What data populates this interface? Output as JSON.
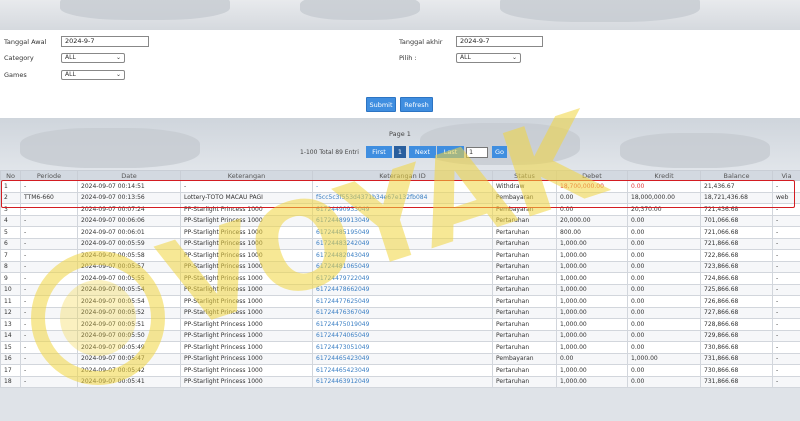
{
  "filters": {
    "tanggal_awal_label": "Tanggal Awal",
    "tanggal_awal_value": "2024-9-7",
    "category_label": "Category",
    "category_value": "ALL",
    "games_label": "Games",
    "games_value": "ALL",
    "tanggal_akhir_label": "Tanggal akhir",
    "tanggal_akhir_value": "2024-9-7",
    "pilih_label": "Pilih :",
    "pilih_value": "ALL",
    "submit_label": "Submit",
    "refresh_label": "Refresh"
  },
  "pager": {
    "page_title": "Page 1",
    "summary": "1-100 Total 89 Entri",
    "first": "First",
    "current": "1",
    "next": "Next",
    "last": "Last",
    "page_input": "1",
    "go": "Go"
  },
  "table": {
    "headers": [
      "No",
      "Periode",
      "Date",
      "Keterangan",
      "Keterangan ID",
      "Status",
      "Debet",
      "Kredit",
      "Balance",
      "Via"
    ],
    "rows": [
      [
        "1",
        "-",
        "2024-09-07 00:14:51",
        "-",
        "-",
        "Withdraw",
        "18,700,000.00",
        "0.00",
        "21,436.67",
        "-"
      ],
      [
        "2",
        "TTM6-660",
        "2024-09-07 00:13:56",
        "Lottery-TOTO MACAU PAGI",
        "f5cc5c3f553d4371b34e67e132fb084",
        "Pembayaran",
        "0.00",
        "18,000,000.00",
        "18,721,436.68",
        "web"
      ],
      [
        "3",
        "-",
        "2024-09-07 00:07:24",
        "PP-Starlight Princess 1000",
        "61724490933049",
        "Pembayaran",
        "0.00",
        "20,370.00",
        "721,436.68",
        "-"
      ],
      [
        "4",
        "-",
        "2024-09-07 00:06:06",
        "PP-Starlight Princess 1000",
        "61724489913049",
        "Pertaruhan",
        "20,000.00",
        "0.00",
        "701,066.68",
        "-"
      ],
      [
        "5",
        "-",
        "2024-09-07 00:06:01",
        "PP-Starlight Princess 1000",
        "61724485195049",
        "Pertaruhan",
        "800.00",
        "0.00",
        "721,066.68",
        "-"
      ],
      [
        "6",
        "-",
        "2024-09-07 00:05:59",
        "PP-Starlight Princess 1000",
        "61724483242049",
        "Pertaruhan",
        "1,000.00",
        "0.00",
        "721,866.68",
        "-"
      ],
      [
        "7",
        "-",
        "2024-09-07 00:05:58",
        "PP-Starlight Princess 1000",
        "61724482043049",
        "Pertaruhan",
        "1,000.00",
        "0.00",
        "722,866.68",
        "-"
      ],
      [
        "8",
        "-",
        "2024-09-07 00:05:57",
        "PP-Starlight Princess 1000",
        "61724481065049",
        "Pertaruhan",
        "1,000.00",
        "0.00",
        "723,866.68",
        "-"
      ],
      [
        "9",
        "-",
        "2024-09-07 00:05:55",
        "PP-Starlight Princess 1000",
        "61724479722049",
        "Pertaruhan",
        "1,000.00",
        "0.00",
        "724,866.68",
        "-"
      ],
      [
        "10",
        "-",
        "2024-09-07 00:05:54",
        "PP-Starlight Princess 1000",
        "61724478662049",
        "Pertaruhan",
        "1,000.00",
        "0.00",
        "725,866.68",
        "-"
      ],
      [
        "11",
        "-",
        "2024-09-07 00:05:54",
        "PP-Starlight Princess 1000",
        "61724477625049",
        "Pertaruhan",
        "1,000.00",
        "0.00",
        "726,866.68",
        "-"
      ],
      [
        "12",
        "-",
        "2024-09-07 00:05:52",
        "PP-Starlight Princess 1000",
        "61724476367049",
        "Pertaruhan",
        "1,000.00",
        "0.00",
        "727,866.68",
        "-"
      ],
      [
        "13",
        "-",
        "2024-09-07 00:05:51",
        "PP-Starlight Princess 1000",
        "61724475019049",
        "Pertaruhan",
        "1,000.00",
        "0.00",
        "728,866.68",
        "-"
      ],
      [
        "14",
        "-",
        "2024-09-07 00:05:50",
        "PP-Starlight Princess 1000",
        "61724474065049",
        "Pertaruhan",
        "1,000.00",
        "0.00",
        "729,866.68",
        "-"
      ],
      [
        "15",
        "-",
        "2024-09-07 00:05:49",
        "PP-Starlight Princess 1000",
        "61724473051049",
        "Pertaruhan",
        "1,000.00",
        "0.00",
        "730,866.68",
        "-"
      ],
      [
        "16",
        "-",
        "2024-09-07 00:05:47",
        "PP-Starlight Princess 1000",
        "61724465423049",
        "Pembayaran",
        "0.00",
        "1,000.00",
        "731,866.68",
        "-"
      ],
      [
        "17",
        "-",
        "2024-09-07 00:05:42",
        "PP-Starlight Princess 1000",
        "61724465423049",
        "Pertaruhan",
        "1,000.00",
        "0.00",
        "730,866.68",
        "-"
      ],
      [
        "18",
        "-",
        "2024-09-07 00:05:41",
        "PP-Starlight Princess 1000",
        "61724463912049",
        "Pertaruhan",
        "1,000.00",
        "0.00",
        "731,866.68",
        "-"
      ]
    ]
  },
  "watermark_text": "VOYAK",
  "colors": {
    "accent": "#3f8ee0",
    "highlight": "#d31d22",
    "link": "#3b7fc4",
    "watermark": "#f2d640"
  }
}
